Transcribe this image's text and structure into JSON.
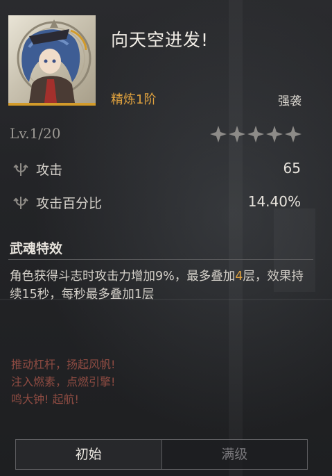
{
  "weapon": {
    "name": "向天空进发!",
    "refinement": "精炼1阶",
    "type": "强袭",
    "level": "Lv.1/20",
    "star_count": 5
  },
  "stats": [
    {
      "icon": "trident-icon",
      "label": "攻击",
      "value": "65"
    },
    {
      "icon": "trident-icon",
      "label": "攻击百分比",
      "value": "14.40%"
    }
  ],
  "effect": {
    "title": "武魂特效",
    "text_a": "角色获得斗志时攻击力增加9%，最多叠加",
    "text_highlight": "4",
    "text_b": "层，效果持续15秒，每秒最多叠加1层"
  },
  "flavor": {
    "line1": "推动杠杆，扬起风帆!",
    "line2": "注入燃素，点燃引擎!",
    "line3": "鸣大钟! 起航!"
  },
  "tabs": {
    "initial": "初始",
    "max": "满级"
  },
  "colors": {
    "accent": "#e0a23e",
    "flavor": "#8e4b42"
  }
}
